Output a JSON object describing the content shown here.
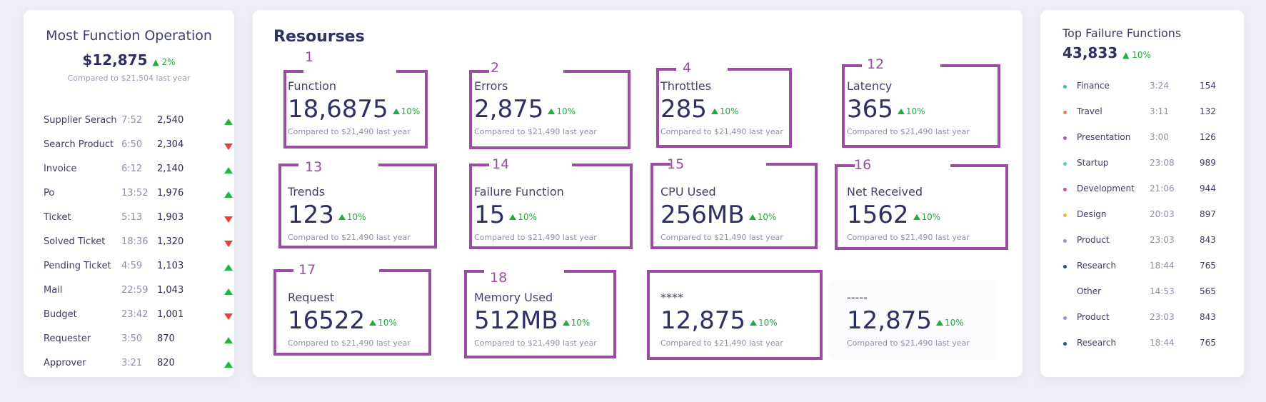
{
  "most_function": {
    "title": "Most Function Operation",
    "total": "$12,875",
    "change": "▲ 2%",
    "compare": "Compared to $21,504 last year",
    "rows": [
      {
        "name": "Supplier Serach",
        "time": "7:52",
        "value": "2,540",
        "trend": "up"
      },
      {
        "name": "Search Product",
        "time": "6:50",
        "value": "2,304",
        "trend": "down"
      },
      {
        "name": "Invoice",
        "time": "6:12",
        "value": "2,140",
        "trend": "up"
      },
      {
        "name": "Po",
        "time": "13:52",
        "value": "1,976",
        "trend": "up"
      },
      {
        "name": "Ticket",
        "time": "5:13",
        "value": "1,903",
        "trend": "down"
      },
      {
        "name": "Solved Ticket",
        "time": "18:36",
        "value": "1,320",
        "trend": "down"
      },
      {
        "name": "Pending Ticket",
        "time": "4:59",
        "value": "1,103",
        "trend": "up"
      },
      {
        "name": "Mail",
        "time": "22:59",
        "value": "1,043",
        "trend": "up"
      },
      {
        "name": "Budget",
        "time": "23:42",
        "value": "1,001",
        "trend": "down"
      },
      {
        "name": "Requester",
        "time": "3:50",
        "value": "870",
        "trend": "up"
      },
      {
        "name": "Approver",
        "time": "3:21",
        "value": "820",
        "trend": "up"
      }
    ]
  },
  "resources": {
    "title": "Resourses",
    "cards": [
      {
        "label": "Function",
        "value": "18,6875",
        "change": "10%",
        "compare": "Compared to $21,490 last year",
        "annotation": "1"
      },
      {
        "label": "Errors",
        "value": "2,875",
        "change": "10%",
        "compare": "Compared to $21,490 last year",
        "annotation": "2"
      },
      {
        "label": "Throttles",
        "value": "285",
        "change": "10%",
        "compare": "Compared to $21,490 last year",
        "annotation": "4"
      },
      {
        "label": "Latency",
        "value": "365",
        "change": "10%",
        "compare": "Compared to $21,490 last year",
        "annotation": "12"
      },
      {
        "label": "Trends",
        "value": "123",
        "change": "10%",
        "compare": "Compared to $21,490 last year",
        "annotation": "13"
      },
      {
        "label": "Failure Function",
        "value": "15",
        "change": "10%",
        "compare": "Compared to $21,490 last year",
        "annotation": "14"
      },
      {
        "label": "CPU Used",
        "value": "256MB",
        "change": "10%",
        "compare": "Compared to $21,490 last year",
        "annotation": "15"
      },
      {
        "label": "Net Received",
        "value": "1562",
        "change": "10%",
        "compare": "Compared to $21,490 last year",
        "annotation": "16"
      },
      {
        "label": "Request",
        "value": "16522",
        "change": "10%",
        "compare": "Compared to $21,490 last year",
        "annotation": "17"
      },
      {
        "label": "Memory Used",
        "value": "512MB",
        "change": "10%",
        "compare": "Compared to $21,490 last year",
        "annotation": "18"
      },
      {
        "label": "****",
        "value": "12,875",
        "change": "10%",
        "compare": "Compared to $21,490 last year",
        "annotation": ""
      },
      {
        "label": "-----",
        "value": "12,875",
        "change": "10%",
        "compare": "Compared to $21,490 last year",
        "annotation": ""
      }
    ]
  },
  "top_failure": {
    "title": "Top Failure Functions",
    "total": "43,833",
    "change": "▲ 10%",
    "rows": [
      {
        "name": "Finance",
        "time": "3:24",
        "value": "154",
        "color": "#2fd07a"
      },
      {
        "name": "Travel",
        "time": "3:11",
        "value": "132",
        "color": "#f27a3a"
      },
      {
        "name": "Presentation",
        "time": "3:00",
        "value": "126",
        "color": "#c44bdc"
      },
      {
        "name": "Startup",
        "time": "23:08",
        "value": "989",
        "color": "#3fd4b0"
      },
      {
        "name": "Development",
        "time": "21:06",
        "value": "944",
        "color": "#f23ab0"
      },
      {
        "name": "Design",
        "time": "20:03",
        "value": "897",
        "color": "#f5b82e"
      },
      {
        "name": "Product",
        "time": "23:03",
        "value": "843",
        "color": "#9c8fd6"
      },
      {
        "name": "Research",
        "time": "18:44",
        "value": "765",
        "color": "#1f4fae"
      },
      {
        "name": "Other",
        "time": "14:53",
        "value": "565",
        "color": "transparent"
      },
      {
        "name": "Product",
        "time": "23:03",
        "value": "843",
        "color": "#9c8fd6"
      },
      {
        "name": "Research",
        "time": "18:44",
        "value": "765",
        "color": "#1f4fae"
      }
    ]
  },
  "colors": {
    "annotation": "#9b4ea1",
    "up": "#22b345",
    "down": "#ee3b3b"
  }
}
